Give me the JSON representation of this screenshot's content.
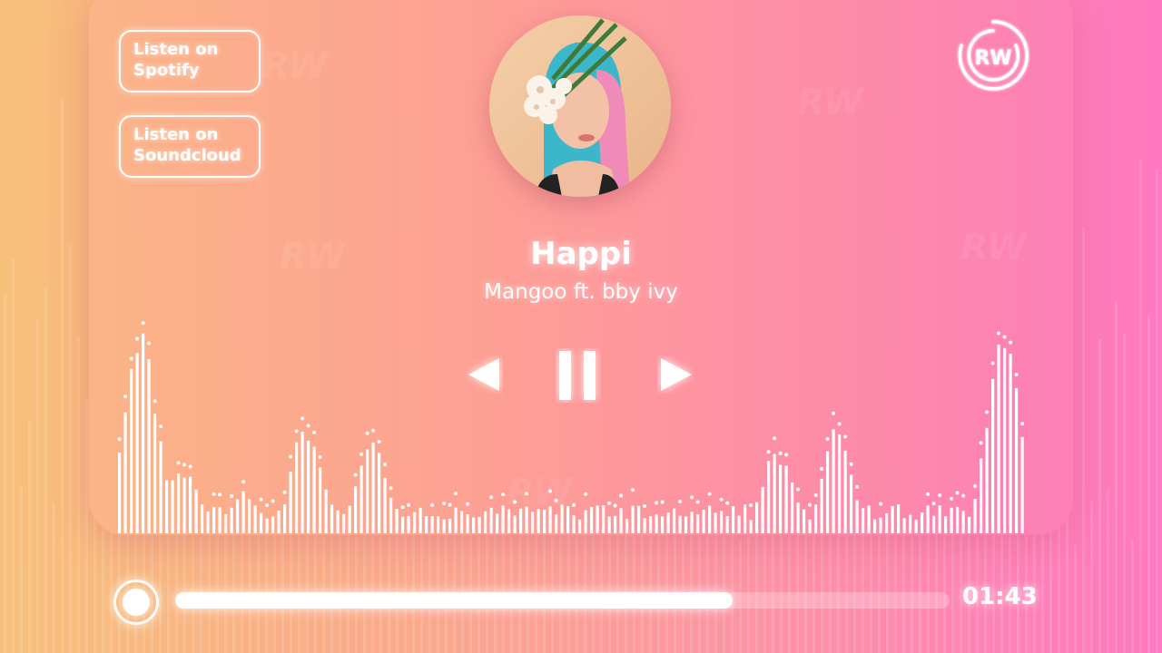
{
  "links": {
    "spotify": [
      "Listen on",
      "Spotify"
    ],
    "soundcloud": [
      "Listen on",
      "Soundcloud"
    ]
  },
  "track": {
    "title": "Happi",
    "artist": "Mangoo ft. bby ivy",
    "elapsed": "01:43",
    "progress_fraction": 0.72
  },
  "brand": {
    "logo_text": "RW"
  },
  "controls": {
    "previous_icon": "previous-icon",
    "pause_icon": "pause-icon",
    "next_icon": "next-icon"
  },
  "colors": {
    "gradient_left": "#f7c07a",
    "gradient_right": "#ff78c0",
    "foreground": "#ffffff"
  }
}
